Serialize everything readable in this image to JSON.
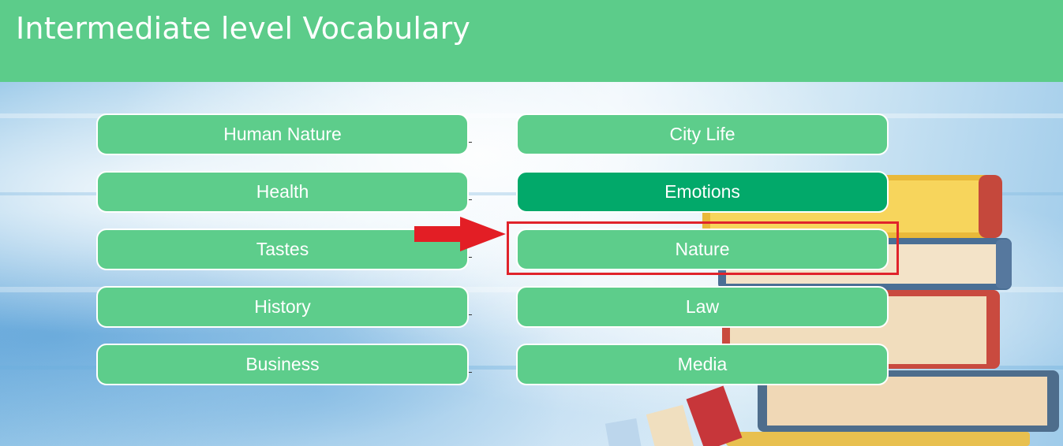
{
  "header": {
    "title": "Intermediate level Vocabulary"
  },
  "topics": {
    "left": [
      {
        "label": "Human Nature"
      },
      {
        "label": "Health"
      },
      {
        "label": "Tastes"
      },
      {
        "label": "History"
      },
      {
        "label": "Business"
      }
    ],
    "right": [
      {
        "label": "City Life"
      },
      {
        "label": "Emotions"
      },
      {
        "label": "Nature"
      },
      {
        "label": "Law"
      },
      {
        "label": "Media"
      }
    ]
  },
  "colors": {
    "header_bg": "#5ccc8a",
    "button_bg": "#5dcd8b",
    "button_active_bg": "#02a96a",
    "annotation_red": "#e0232b"
  },
  "annotation": {
    "highlighted_topic": "Nature",
    "arrow_icon": "red-right-arrow-icon"
  }
}
